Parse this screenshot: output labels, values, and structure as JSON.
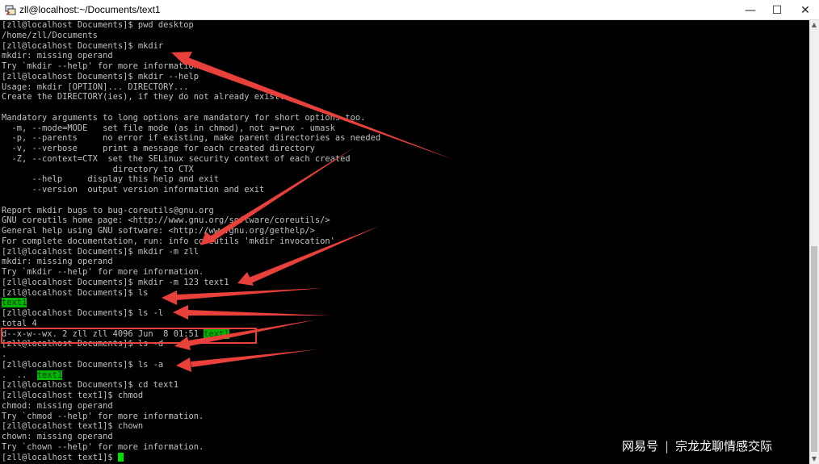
{
  "window": {
    "title": "zll@localhost:~/Documents/text1",
    "minimize": "—",
    "maximize": "☐",
    "close": "✕",
    "icon": "putty-terminal-icon"
  },
  "terminal": {
    "lines": [
      {
        "text": "[zll@localhost Documents]$ pwd desktop"
      },
      {
        "text": "/home/zll/Documents"
      },
      {
        "text": "[zll@localhost Documents]$ mkdir"
      },
      {
        "text": "mkdir: missing operand"
      },
      {
        "text": "Try `mkdir --help' for more information."
      },
      {
        "text": "[zll@localhost Documents]$ mkdir --help"
      },
      {
        "text": "Usage: mkdir [OPTION]... DIRECTORY..."
      },
      {
        "text": "Create the DIRECTORY(ies), if they do not already exist."
      },
      {
        "text": ""
      },
      {
        "text": "Mandatory arguments to long options are mandatory for short options too."
      },
      {
        "text": "  -m, --mode=MODE   set file mode (as in chmod), not a=rwx - umask"
      },
      {
        "text": "  -p, --parents     no error if existing, make parent directories as needed"
      },
      {
        "text": "  -v, --verbose     print a message for each created directory"
      },
      {
        "text": "  -Z, --context=CTX  set the SELinux security context of each created"
      },
      {
        "text": "                      directory to CTX"
      },
      {
        "text": "      --help     display this help and exit"
      },
      {
        "text": "      --version  output version information and exit"
      },
      {
        "text": ""
      },
      {
        "text": "Report mkdir bugs to bug-coreutils@gnu.org"
      },
      {
        "text": "GNU coreutils home page: <http://www.gnu.org/software/coreutils/>"
      },
      {
        "text": "General help using GNU software: <http://www.gnu.org/gethelp/>"
      },
      {
        "text": "For complete documentation, run: info coreutils 'mkdir invocation'"
      },
      {
        "text": "[zll@localhost Documents]$ mkdir -m zll"
      },
      {
        "text": "mkdir: missing operand"
      },
      {
        "text": "Try `mkdir --help' for more information."
      },
      {
        "text": "[zll@localhost Documents]$ mkdir -m 123 text1"
      },
      {
        "text": "[zll@localhost Documents]$ ls"
      },
      {
        "text": "",
        "hl": "text1"
      },
      {
        "text": "[zll@localhost Documents]$ ls -l"
      },
      {
        "text": "total 4"
      },
      {
        "text": "d--x-w--wx. 2 zll zll 4096 Jun  8 01:51 ",
        "hl": "text1"
      },
      {
        "text": "[zll@localhost Documents]$ ls -d"
      },
      {
        "text": "."
      },
      {
        "text": "[zll@localhost Documents]$ ls -a"
      },
      {
        "text": ".  ..  ",
        "hl": "text1"
      },
      {
        "text": "[zll@localhost Documents]$ cd text1"
      },
      {
        "text": "[zll@localhost text1]$ chmod"
      },
      {
        "text": "chmod: missing operand"
      },
      {
        "text": "Try `chmod --help' for more information."
      },
      {
        "text": "[zll@localhost text1]$ chown"
      },
      {
        "text": "chown: missing operand"
      },
      {
        "text": "Try `chown --help' for more information."
      },
      {
        "text": "[zll@localhost text1]$ ",
        "cursor": true
      }
    ]
  },
  "watermark": {
    "brand": "网易号",
    "separator": "|",
    "author": "宗龙龙聊情感交际"
  },
  "colors": {
    "terminal_bg": "#000000",
    "terminal_fg": "#c0c0c0",
    "highlight_bg": "#00b400",
    "annotation_red": "#e8403a"
  }
}
